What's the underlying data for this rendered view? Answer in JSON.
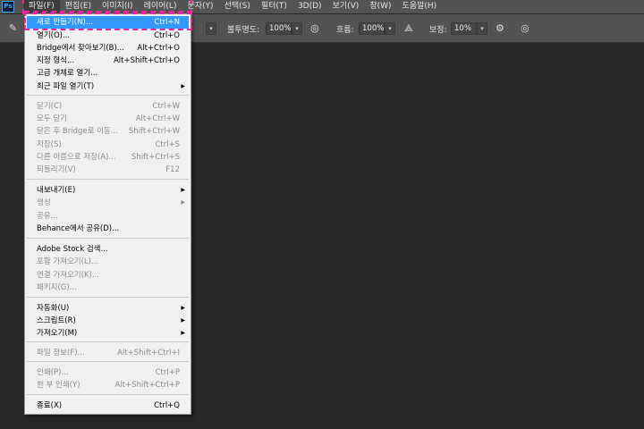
{
  "app": {
    "logo_text": "Ps"
  },
  "menubar": [
    "파일(F)",
    "편집(E)",
    "이미지(I)",
    "레이어(L)",
    "문자(Y)",
    "선택(S)",
    "필터(T)",
    "3D(D)",
    "보기(V)",
    "창(W)",
    "도움말(H)"
  ],
  "options": {
    "opacity_label": "불투명도:",
    "opacity_value": "100%",
    "flow_label": "흐름:",
    "flow_value": "100%",
    "smoothing_label": "보정:",
    "smoothing_value": "10%"
  },
  "file_menu": {
    "items": [
      {
        "label": "새로 만들기(N)...",
        "shortcut": "Ctrl+N",
        "enabled": true,
        "highlighted": true
      },
      {
        "label": "열기(O)...",
        "shortcut": "Ctrl+O",
        "enabled": true
      },
      {
        "label": "Bridge에서 찾아보기(B)...",
        "shortcut": "Alt+Ctrl+O",
        "enabled": true
      },
      {
        "label": "지정 형식...",
        "shortcut": "Alt+Shift+Ctrl+O",
        "enabled": true
      },
      {
        "label": "고급 개체로 열기...",
        "shortcut": "",
        "enabled": true
      },
      {
        "label": "최근 파일 열기(T)",
        "shortcut": "",
        "enabled": true,
        "submenu": true
      },
      {
        "label": "닫기(C)",
        "shortcut": "Ctrl+W",
        "enabled": false
      },
      {
        "label": "모두 닫기",
        "shortcut": "Alt+Ctrl+W",
        "enabled": false
      },
      {
        "label": "닫은 후 Bridge로 이동...",
        "shortcut": "Shift+Ctrl+W",
        "enabled": false
      },
      {
        "label": "저장(S)",
        "shortcut": "Ctrl+S",
        "enabled": false
      },
      {
        "label": "다른 이름으로 저장(A)...",
        "shortcut": "Shift+Ctrl+S",
        "enabled": false
      },
      {
        "label": "되돌리기(V)",
        "shortcut": "F12",
        "enabled": false
      },
      {
        "label": "내보내기(E)",
        "shortcut": "",
        "enabled": true,
        "submenu": true
      },
      {
        "label": "생성",
        "shortcut": "",
        "enabled": false,
        "submenu": true
      },
      {
        "label": "공유...",
        "shortcut": "",
        "enabled": false
      },
      {
        "label": "Behance에서 공유(D)...",
        "shortcut": "",
        "enabled": true
      },
      {
        "label": "Adobe Stock 검색...",
        "shortcut": "",
        "enabled": true
      },
      {
        "label": "포함 가져오기(L)...",
        "shortcut": "",
        "enabled": false
      },
      {
        "label": "연결 가져오기(K)...",
        "shortcut": "",
        "enabled": false
      },
      {
        "label": "패키지(G)...",
        "shortcut": "",
        "enabled": false
      },
      {
        "label": "자동화(U)",
        "shortcut": "",
        "enabled": true,
        "submenu": true
      },
      {
        "label": "스크립트(R)",
        "shortcut": "",
        "enabled": true,
        "submenu": true
      },
      {
        "label": "가져오기(M)",
        "shortcut": "",
        "enabled": true,
        "submenu": true
      },
      {
        "label": "파일 정보(F)...",
        "shortcut": "Alt+Shift+Ctrl+I",
        "enabled": false
      },
      {
        "label": "인쇄(P)...",
        "shortcut": "Ctrl+P",
        "enabled": false
      },
      {
        "label": "한 부 인쇄(Y)",
        "shortcut": "Alt+Shift+Ctrl+P",
        "enabled": false
      },
      {
        "label": "종료(X)",
        "shortcut": "Ctrl+Q",
        "enabled": true
      }
    ]
  }
}
